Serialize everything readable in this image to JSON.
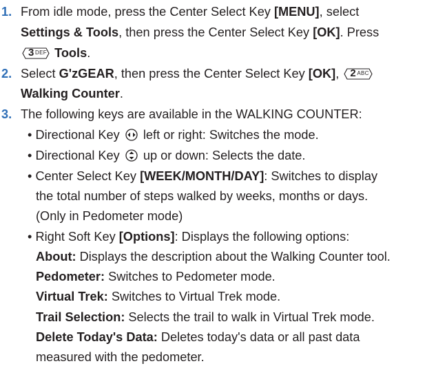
{
  "steps": [
    {
      "number": "1.",
      "t1": "From idle mode, press the Center Select Key ",
      "menu_key": "[MENU]",
      "t2": ", select",
      "settings": "Settings & Tools",
      "t3": ", then press the Center Select Key ",
      "ok_key": "[OK]",
      "t4": ". Press",
      "key_digit": "3",
      "key_letters": "DEF",
      "tools": "Tools",
      "t5": "."
    },
    {
      "number": "2.",
      "t1": "Select ",
      "gzgear": "G'zGEAR",
      "t2": ", then press the Center Select Key ",
      "ok_key": "[OK]",
      "t3": ",",
      "key_digit": "2",
      "key_letters": "ABC",
      "walking": "Walking Counter",
      "t4": "."
    },
    {
      "number": "3.",
      "intro": "The following keys are available in the WALKING COUNTER:",
      "bullet": "•",
      "b1_pre": "Directional Key",
      "b1_post": "left or right: Switches the mode.",
      "b2_pre": "Directional Key",
      "b2_post": "up or down: Selects the date.",
      "b3_pre": "Center Select Key ",
      "b3_key": "[WEEK/MONTH/DAY]",
      "b3_l1": ": Switches to display",
      "b3_l2": "the total number of steps walked by weeks, months or days.",
      "b3_l3": "(Only in Pedometer mode)",
      "b4_pre": "Right Soft Key ",
      "b4_key": "[Options]",
      "b4_post": ": Displays the following options:",
      "options": [
        {
          "label": "About:",
          "desc": " Displays the description about the Walking Counter tool."
        },
        {
          "label": "Pedometer:",
          "desc": " Switches to Pedometer mode."
        },
        {
          "label": "Virtual Trek:",
          "desc": " Switches to Virtual Trek mode."
        },
        {
          "label": "Trail Selection:",
          "desc": " Selects the trail to walk in Virtual Trek mode."
        },
        {
          "label": "Delete Today's Data:",
          "desc": " Deletes today's data or all past data"
        }
      ],
      "last_line": "measured with the pedometer."
    }
  ],
  "colors": {
    "step_number": "#2f6fb7",
    "text": "#231f20"
  },
  "icons": {
    "dpad_lr": "dpad-left-right-icon",
    "dpad_ud": "dpad-up-down-icon",
    "keypad": "keypad-key-icon"
  }
}
